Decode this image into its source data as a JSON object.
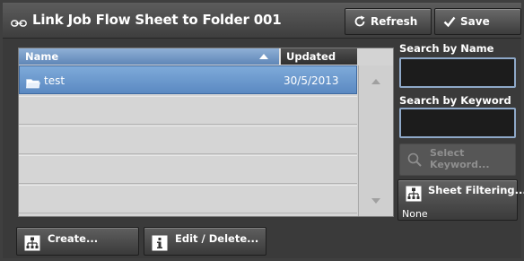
{
  "header": {
    "title": "Link Job Flow Sheet to Folder 001",
    "title_icon": "link-icon",
    "refresh_label": "Refresh",
    "refresh_icon": "refresh-icon",
    "save_label": "Save",
    "save_icon": "checkmark-icon"
  },
  "list": {
    "columns": {
      "name": "Name",
      "updated": "Updated"
    },
    "sort": "name-ascending",
    "rows": [
      {
        "name": "test",
        "updated": "30/5/2013",
        "icon": "folder-icon",
        "selected": true
      }
    ]
  },
  "search": {
    "by_name_label": "Search by Name",
    "by_name_value": "",
    "by_keyword_label": "Search by Keyword",
    "by_keyword_value": "",
    "select_keyword_label": "Select\nKeyword...",
    "select_keyword_enabled": false
  },
  "filter": {
    "sheet_filtering_label": "Sheet Filtering...",
    "sheet_filtering_value": "None"
  },
  "actions": {
    "create_label": "Create...",
    "edit_delete_label": "Edit / Delete..."
  },
  "colors": {
    "selection": "#6d99cf",
    "header_bar": "#4a4a4a",
    "input_border": "#8ea8c8"
  }
}
